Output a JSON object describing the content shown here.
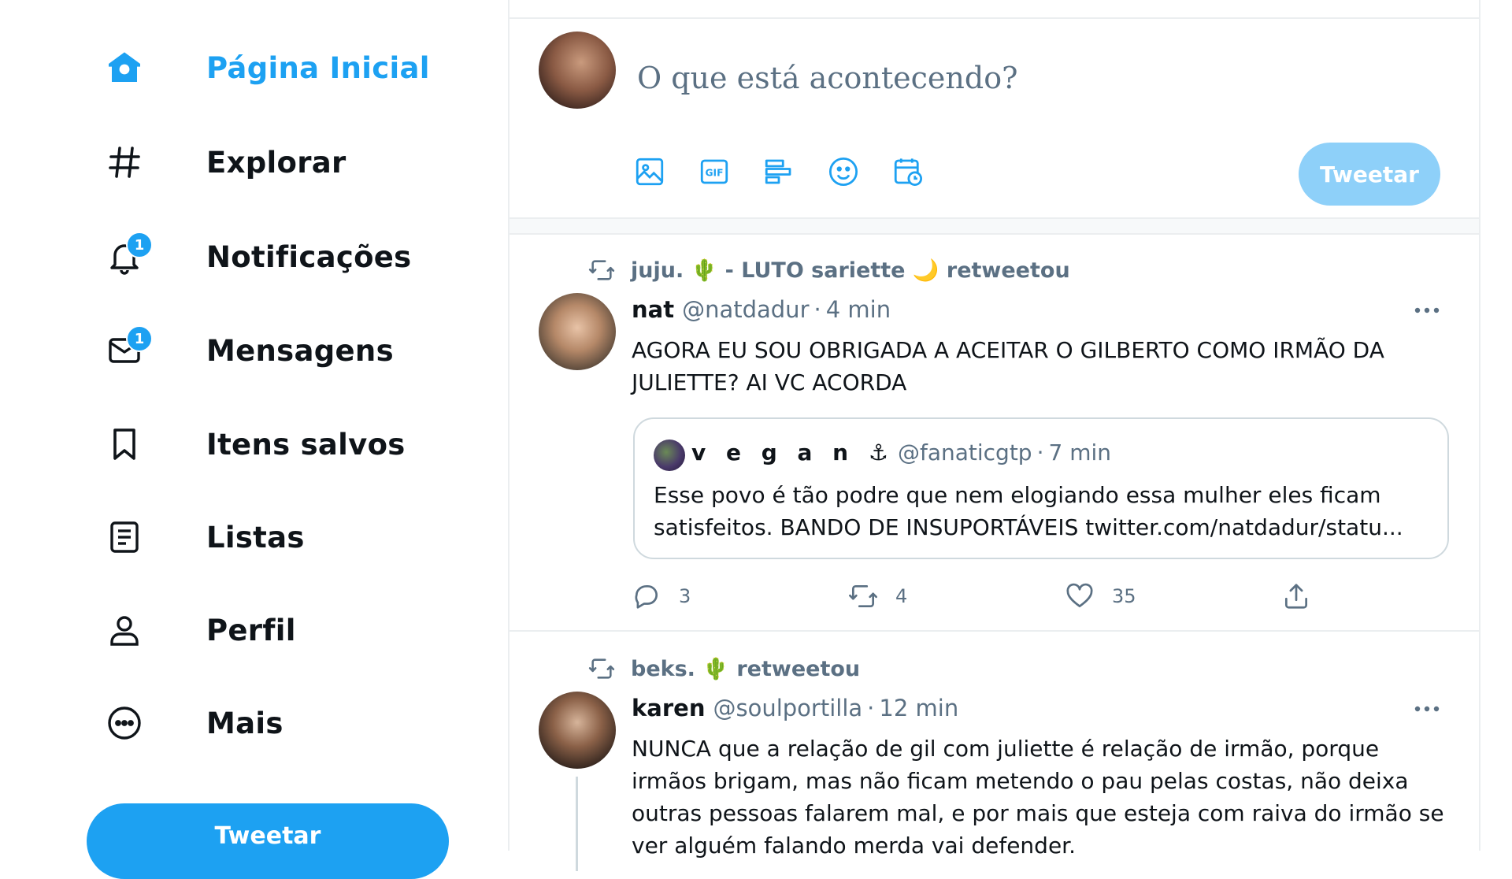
{
  "sidebar": {
    "items": [
      {
        "label": "Página Inicial",
        "icon": "home-icon",
        "active": true
      },
      {
        "label": "Explorar",
        "icon": "hashtag-icon"
      },
      {
        "label": "Notificações",
        "icon": "bell-icon",
        "badge": "1"
      },
      {
        "label": "Mensagens",
        "icon": "mail-icon",
        "badge": "1"
      },
      {
        "label": "Itens salvos",
        "icon": "bookmark-icon"
      },
      {
        "label": "Listas",
        "icon": "list-icon"
      },
      {
        "label": "Perfil",
        "icon": "person-icon"
      },
      {
        "label": "Mais",
        "icon": "more-circle-icon"
      }
    ],
    "tweet_button": "Tweetar"
  },
  "composer": {
    "placeholder": "O que está acontecendo?",
    "tools": [
      "image-icon",
      "gif-icon",
      "poll-icon",
      "emoji-icon",
      "schedule-icon"
    ],
    "tweet_button": "Tweetar"
  },
  "tweets": [
    {
      "retweeted_by": "juju. 🌵 - LUTO sariette 🌙 retweetou",
      "name": "nat",
      "handle": "@natdadur",
      "time": "4 min",
      "text": "AGORA EU SOU OBRIGADA A ACEITAR O GILBERTO COMO IRMÃO DA JULIETTE? AI VC ACORDA",
      "quote": {
        "name": "v e g a n ⚓",
        "handle": "@fanaticgtp",
        "time": "7 min",
        "text": "Esse povo é tão podre que nem elogiando essa mulher eles ficam satisfeitos. BANDO DE INSUPORTÁVEIS twitter.com/natdadur/statu..."
      },
      "replies": "3",
      "retweets": "4",
      "likes": "35"
    },
    {
      "retweeted_by": "beks. 🌵 retweetou",
      "name": "karen",
      "handle": "@soulportilla",
      "time": "12 min",
      "text": "NUNCA que a relação de gil com juliette é relação de irmão, porque irmãos brigam, mas não ficam metendo o pau pelas costas, não deixa outras pessoas falarem mal, e por mais que esteja com raiva do irmão se ver alguém falando merda vai defender."
    }
  ],
  "colors": {
    "accent": "#1da1f2",
    "accent_disabled": "#8ed0f9",
    "secondary_text": "#5b7083",
    "border": "#ebeef0"
  }
}
